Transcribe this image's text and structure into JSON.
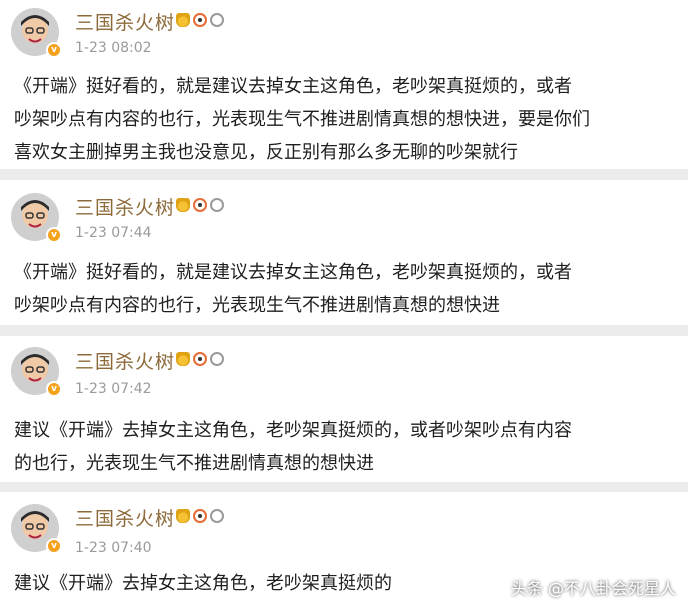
{
  "posts": [
    {
      "user": "三国杀火树",
      "time": "1-23 08:02",
      "lines": [
        "《开端》挺好看的，就是建议去掉女主这角色，老吵架真挺烦的，或者",
        "吵架吵点有内容的也行，光表现生气不推进剧情真想的想快进，要是你们",
        "喜欢女主删掉男主我也没意见，反正别有那么多无聊的吵架就行"
      ]
    },
    {
      "user": "三国杀火树",
      "time": "1-23 07:44",
      "lines": [
        "《开端》挺好看的，就是建议去掉女主这角色，老吵架真挺烦的，或者",
        "吵架吵点有内容的也行，光表现生气不推进剧情真想的想快进"
      ]
    },
    {
      "user": "三国杀火树",
      "time": "1-23 07:42",
      "lines": [
        "建议《开端》去掉女主这角色，老吵架真挺烦的，或者吵架吵点有内容",
        "的也行，光表现生气不推进剧情真想的想快进"
      ]
    },
    {
      "user": "三国杀火树",
      "time": "1-23 07:40",
      "lines": [
        "建议《开端》去掉女主这角色，老吵架真挺烦的"
      ]
    }
  ],
  "watermark": "头条 @不八卦会死星人",
  "colors": {
    "name": "#8d6a3a",
    "time": "#9a9a9a",
    "text": "#1f1f1f",
    "separator": "#ececec"
  }
}
